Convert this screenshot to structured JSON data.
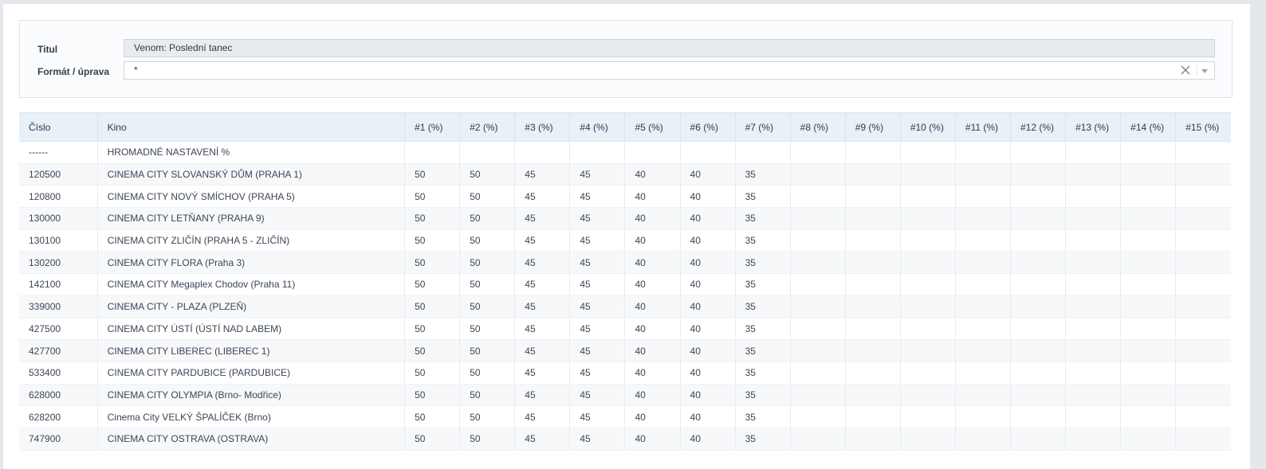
{
  "filters": {
    "title_label": "Titul",
    "title_value": "Venom: Poslední tanec",
    "format_label": "Formát / úprava",
    "format_value": "*"
  },
  "table": {
    "columns": [
      "Číslo",
      "Kino",
      "#1 (%)",
      "#2 (%)",
      "#3 (%)",
      "#4 (%)",
      "#5 (%)",
      "#6 (%)",
      "#7 (%)",
      "#8 (%)",
      "#9 (%)",
      "#10 (%)",
      "#11 (%)",
      "#12 (%)",
      "#13 (%)",
      "#14 (%)",
      "#15 (%)"
    ],
    "rows": [
      [
        "------",
        "HROMADNÉ NASTAVENÍ %",
        "",
        "",
        "",
        "",
        "",
        "",
        "",
        "",
        "",
        "",
        "",
        "",
        "",
        "",
        ""
      ],
      [
        "120500",
        "CINEMA CITY SLOVANSKÝ DŮM (PRAHA 1)",
        "50",
        "50",
        "45",
        "45",
        "40",
        "40",
        "35",
        "",
        "",
        "",
        "",
        "",
        "",
        "",
        ""
      ],
      [
        "120800",
        "CINEMA CITY NOVÝ SMÍCHOV (PRAHA 5)",
        "50",
        "50",
        "45",
        "45",
        "40",
        "40",
        "35",
        "",
        "",
        "",
        "",
        "",
        "",
        "",
        ""
      ],
      [
        "130000",
        "CINEMA CITY LETŇANY (PRAHA 9)",
        "50",
        "50",
        "45",
        "45",
        "40",
        "40",
        "35",
        "",
        "",
        "",
        "",
        "",
        "",
        "",
        ""
      ],
      [
        "130100",
        "CINEMA CITY ZLIČÍN (PRAHA 5 - ZLIČÍN)",
        "50",
        "50",
        "45",
        "45",
        "40",
        "40",
        "35",
        "",
        "",
        "",
        "",
        "",
        "",
        "",
        ""
      ],
      [
        "130200",
        "CINEMA CITY FLORA (Praha 3)",
        "50",
        "50",
        "45",
        "45",
        "40",
        "40",
        "35",
        "",
        "",
        "",
        "",
        "",
        "",
        "",
        ""
      ],
      [
        "142100",
        "CINEMA CITY Megaplex Chodov (Praha 11)",
        "50",
        "50",
        "45",
        "45",
        "40",
        "40",
        "35",
        "",
        "",
        "",
        "",
        "",
        "",
        "",
        ""
      ],
      [
        "339000",
        "CINEMA CITY - PLAZA (PLZEŇ)",
        "50",
        "50",
        "45",
        "45",
        "40",
        "40",
        "35",
        "",
        "",
        "",
        "",
        "",
        "",
        "",
        ""
      ],
      [
        "427500",
        "CINEMA CITY ÚSTÍ (ÚSTÍ NAD LABEM)",
        "50",
        "50",
        "45",
        "45",
        "40",
        "40",
        "35",
        "",
        "",
        "",
        "",
        "",
        "",
        "",
        ""
      ],
      [
        "427700",
        "CINEMA CITY LIBEREC (LIBEREC 1)",
        "50",
        "50",
        "45",
        "45",
        "40",
        "40",
        "35",
        "",
        "",
        "",
        "",
        "",
        "",
        "",
        ""
      ],
      [
        "533400",
        "CINEMA CITY PARDUBICE (PARDUBICE)",
        "50",
        "50",
        "45",
        "45",
        "40",
        "40",
        "35",
        "",
        "",
        "",
        "",
        "",
        "",
        "",
        ""
      ],
      [
        "628000",
        "CINEMA CITY OLYMPIA (Brno- Modřice)",
        "50",
        "50",
        "45",
        "45",
        "40",
        "40",
        "35",
        "",
        "",
        "",
        "",
        "",
        "",
        "",
        ""
      ],
      [
        "628200",
        "Cinema City VELKÝ ŠPALÍČEK (Brno)",
        "50",
        "50",
        "45",
        "45",
        "40",
        "40",
        "35",
        "",
        "",
        "",
        "",
        "",
        "",
        "",
        ""
      ],
      [
        "747900",
        "CINEMA CITY OSTRAVA (OSTRAVA)",
        "50",
        "50",
        "45",
        "45",
        "40",
        "40",
        "35",
        "",
        "",
        "",
        "",
        "",
        "",
        "",
        ""
      ]
    ]
  }
}
